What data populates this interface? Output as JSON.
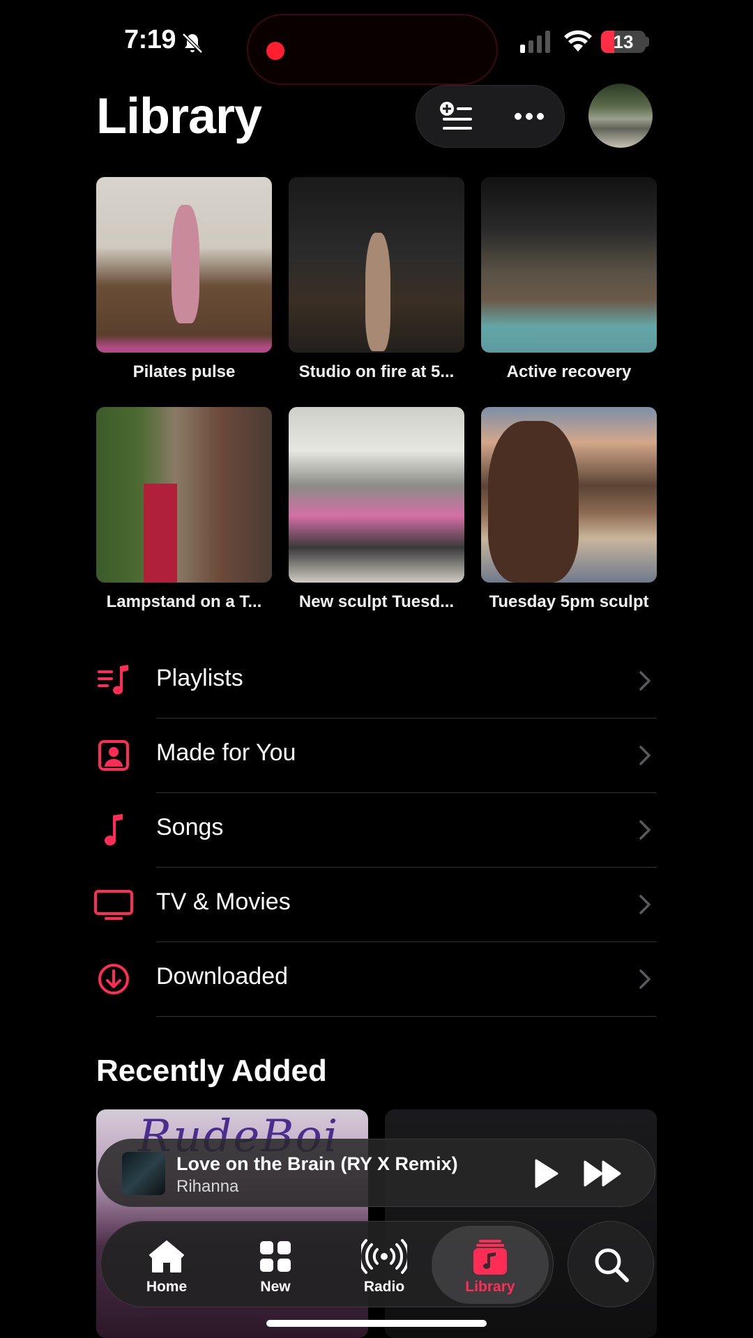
{
  "status": {
    "time": "7:19",
    "battery": "13",
    "battery_level": 0.13
  },
  "header": {
    "title": "Library"
  },
  "grid": [
    {
      "label": "Pilates pulse"
    },
    {
      "label": "Studio on fire at 5..."
    },
    {
      "label": "Active recovery"
    },
    {
      "label": "Lampstand on a T..."
    },
    {
      "label": "New sculpt Tuesd..."
    },
    {
      "label": "Tuesday 5pm sculpt"
    }
  ],
  "menu": [
    {
      "label": "Playlists",
      "icon": "playlists-icon"
    },
    {
      "label": "Made for You",
      "icon": "person-square-icon"
    },
    {
      "label": "Songs",
      "icon": "music-note-icon"
    },
    {
      "label": "TV & Movies",
      "icon": "tv-icon"
    },
    {
      "label": "Downloaded",
      "icon": "download-circle-icon"
    }
  ],
  "recently_added": {
    "title": "Recently Added",
    "art_text": "RudeBoi"
  },
  "now_playing": {
    "title": "Love on the Brain (RY X Remix)",
    "artist": "Rihanna"
  },
  "tabs": [
    {
      "label": "Home",
      "icon": "house-icon"
    },
    {
      "label": "New",
      "icon": "grid-icon"
    },
    {
      "label": "Radio",
      "icon": "radio-waves-icon"
    },
    {
      "label": "Library",
      "icon": "music-library-icon",
      "active": true
    }
  ],
  "colors": {
    "accent": "#ff2d55",
    "background": "#000000"
  }
}
